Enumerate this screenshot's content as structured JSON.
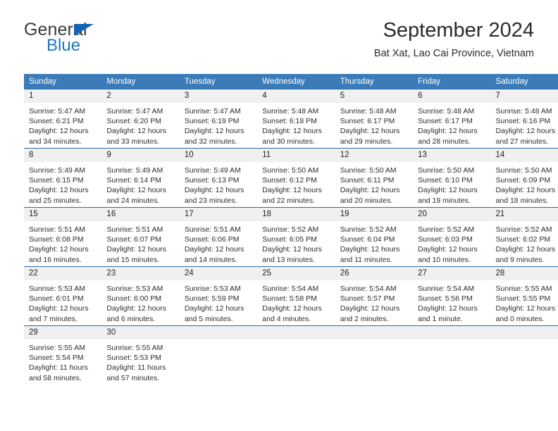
{
  "brand": {
    "name_part1": "General",
    "name_part2": "Blue",
    "accent_color": "#1e78c8",
    "flag_color": "#1263b0"
  },
  "header": {
    "title": "September 2024",
    "subtitle": "Bat Xat, Lao Cai Province, Vietnam"
  },
  "calendar": {
    "header_bg": "#3b7cb8",
    "daynum_bg": "#f0f0f0",
    "grid_line": "#2c6ca5",
    "weekdays": [
      "Sunday",
      "Monday",
      "Tuesday",
      "Wednesday",
      "Thursday",
      "Friday",
      "Saturday"
    ],
    "weeks": [
      [
        {
          "day": "1",
          "sunrise": "Sunrise: 5:47 AM",
          "sunset": "Sunset: 6:21 PM",
          "daylight1": "Daylight: 12 hours",
          "daylight2": "and 34 minutes."
        },
        {
          "day": "2",
          "sunrise": "Sunrise: 5:47 AM",
          "sunset": "Sunset: 6:20 PM",
          "daylight1": "Daylight: 12 hours",
          "daylight2": "and 33 minutes."
        },
        {
          "day": "3",
          "sunrise": "Sunrise: 5:47 AM",
          "sunset": "Sunset: 6:19 PM",
          "daylight1": "Daylight: 12 hours",
          "daylight2": "and 32 minutes."
        },
        {
          "day": "4",
          "sunrise": "Sunrise: 5:48 AM",
          "sunset": "Sunset: 6:18 PM",
          "daylight1": "Daylight: 12 hours",
          "daylight2": "and 30 minutes."
        },
        {
          "day": "5",
          "sunrise": "Sunrise: 5:48 AM",
          "sunset": "Sunset: 6:17 PM",
          "daylight1": "Daylight: 12 hours",
          "daylight2": "and 29 minutes."
        },
        {
          "day": "6",
          "sunrise": "Sunrise: 5:48 AM",
          "sunset": "Sunset: 6:17 PM",
          "daylight1": "Daylight: 12 hours",
          "daylight2": "and 28 minutes."
        },
        {
          "day": "7",
          "sunrise": "Sunrise: 5:48 AM",
          "sunset": "Sunset: 6:16 PM",
          "daylight1": "Daylight: 12 hours",
          "daylight2": "and 27 minutes."
        }
      ],
      [
        {
          "day": "8",
          "sunrise": "Sunrise: 5:49 AM",
          "sunset": "Sunset: 6:15 PM",
          "daylight1": "Daylight: 12 hours",
          "daylight2": "and 25 minutes."
        },
        {
          "day": "9",
          "sunrise": "Sunrise: 5:49 AM",
          "sunset": "Sunset: 6:14 PM",
          "daylight1": "Daylight: 12 hours",
          "daylight2": "and 24 minutes."
        },
        {
          "day": "10",
          "sunrise": "Sunrise: 5:49 AM",
          "sunset": "Sunset: 6:13 PM",
          "daylight1": "Daylight: 12 hours",
          "daylight2": "and 23 minutes."
        },
        {
          "day": "11",
          "sunrise": "Sunrise: 5:50 AM",
          "sunset": "Sunset: 6:12 PM",
          "daylight1": "Daylight: 12 hours",
          "daylight2": "and 22 minutes."
        },
        {
          "day": "12",
          "sunrise": "Sunrise: 5:50 AM",
          "sunset": "Sunset: 6:11 PM",
          "daylight1": "Daylight: 12 hours",
          "daylight2": "and 20 minutes."
        },
        {
          "day": "13",
          "sunrise": "Sunrise: 5:50 AM",
          "sunset": "Sunset: 6:10 PM",
          "daylight1": "Daylight: 12 hours",
          "daylight2": "and 19 minutes."
        },
        {
          "day": "14",
          "sunrise": "Sunrise: 5:50 AM",
          "sunset": "Sunset: 6:09 PM",
          "daylight1": "Daylight: 12 hours",
          "daylight2": "and 18 minutes."
        }
      ],
      [
        {
          "day": "15",
          "sunrise": "Sunrise: 5:51 AM",
          "sunset": "Sunset: 6:08 PM",
          "daylight1": "Daylight: 12 hours",
          "daylight2": "and 16 minutes."
        },
        {
          "day": "16",
          "sunrise": "Sunrise: 5:51 AM",
          "sunset": "Sunset: 6:07 PM",
          "daylight1": "Daylight: 12 hours",
          "daylight2": "and 15 minutes."
        },
        {
          "day": "17",
          "sunrise": "Sunrise: 5:51 AM",
          "sunset": "Sunset: 6:06 PM",
          "daylight1": "Daylight: 12 hours",
          "daylight2": "and 14 minutes."
        },
        {
          "day": "18",
          "sunrise": "Sunrise: 5:52 AM",
          "sunset": "Sunset: 6:05 PM",
          "daylight1": "Daylight: 12 hours",
          "daylight2": "and 13 minutes."
        },
        {
          "day": "19",
          "sunrise": "Sunrise: 5:52 AM",
          "sunset": "Sunset: 6:04 PM",
          "daylight1": "Daylight: 12 hours",
          "daylight2": "and 11 minutes."
        },
        {
          "day": "20",
          "sunrise": "Sunrise: 5:52 AM",
          "sunset": "Sunset: 6:03 PM",
          "daylight1": "Daylight: 12 hours",
          "daylight2": "and 10 minutes."
        },
        {
          "day": "21",
          "sunrise": "Sunrise: 5:52 AM",
          "sunset": "Sunset: 6:02 PM",
          "daylight1": "Daylight: 12 hours",
          "daylight2": "and 9 minutes."
        }
      ],
      [
        {
          "day": "22",
          "sunrise": "Sunrise: 5:53 AM",
          "sunset": "Sunset: 6:01 PM",
          "daylight1": "Daylight: 12 hours",
          "daylight2": "and 7 minutes."
        },
        {
          "day": "23",
          "sunrise": "Sunrise: 5:53 AM",
          "sunset": "Sunset: 6:00 PM",
          "daylight1": "Daylight: 12 hours",
          "daylight2": "and 6 minutes."
        },
        {
          "day": "24",
          "sunrise": "Sunrise: 5:53 AM",
          "sunset": "Sunset: 5:59 PM",
          "daylight1": "Daylight: 12 hours",
          "daylight2": "and 5 minutes."
        },
        {
          "day": "25",
          "sunrise": "Sunrise: 5:54 AM",
          "sunset": "Sunset: 5:58 PM",
          "daylight1": "Daylight: 12 hours",
          "daylight2": "and 4 minutes."
        },
        {
          "day": "26",
          "sunrise": "Sunrise: 5:54 AM",
          "sunset": "Sunset: 5:57 PM",
          "daylight1": "Daylight: 12 hours",
          "daylight2": "and 2 minutes."
        },
        {
          "day": "27",
          "sunrise": "Sunrise: 5:54 AM",
          "sunset": "Sunset: 5:56 PM",
          "daylight1": "Daylight: 12 hours",
          "daylight2": "and 1 minute."
        },
        {
          "day": "28",
          "sunrise": "Sunrise: 5:55 AM",
          "sunset": "Sunset: 5:55 PM",
          "daylight1": "Daylight: 12 hours",
          "daylight2": "and 0 minutes."
        }
      ],
      [
        {
          "day": "29",
          "sunrise": "Sunrise: 5:55 AM",
          "sunset": "Sunset: 5:54 PM",
          "daylight1": "Daylight: 11 hours",
          "daylight2": "and 58 minutes."
        },
        {
          "day": "30",
          "sunrise": "Sunrise: 5:55 AM",
          "sunset": "Sunset: 5:53 PM",
          "daylight1": "Daylight: 11 hours",
          "daylight2": "and 57 minutes."
        },
        {
          "day": "",
          "sunrise": "",
          "sunset": "",
          "daylight1": "",
          "daylight2": ""
        },
        {
          "day": "",
          "sunrise": "",
          "sunset": "",
          "daylight1": "",
          "daylight2": ""
        },
        {
          "day": "",
          "sunrise": "",
          "sunset": "",
          "daylight1": "",
          "daylight2": ""
        },
        {
          "day": "",
          "sunrise": "",
          "sunset": "",
          "daylight1": "",
          "daylight2": ""
        },
        {
          "day": "",
          "sunrise": "",
          "sunset": "",
          "daylight1": "",
          "daylight2": ""
        }
      ]
    ]
  }
}
